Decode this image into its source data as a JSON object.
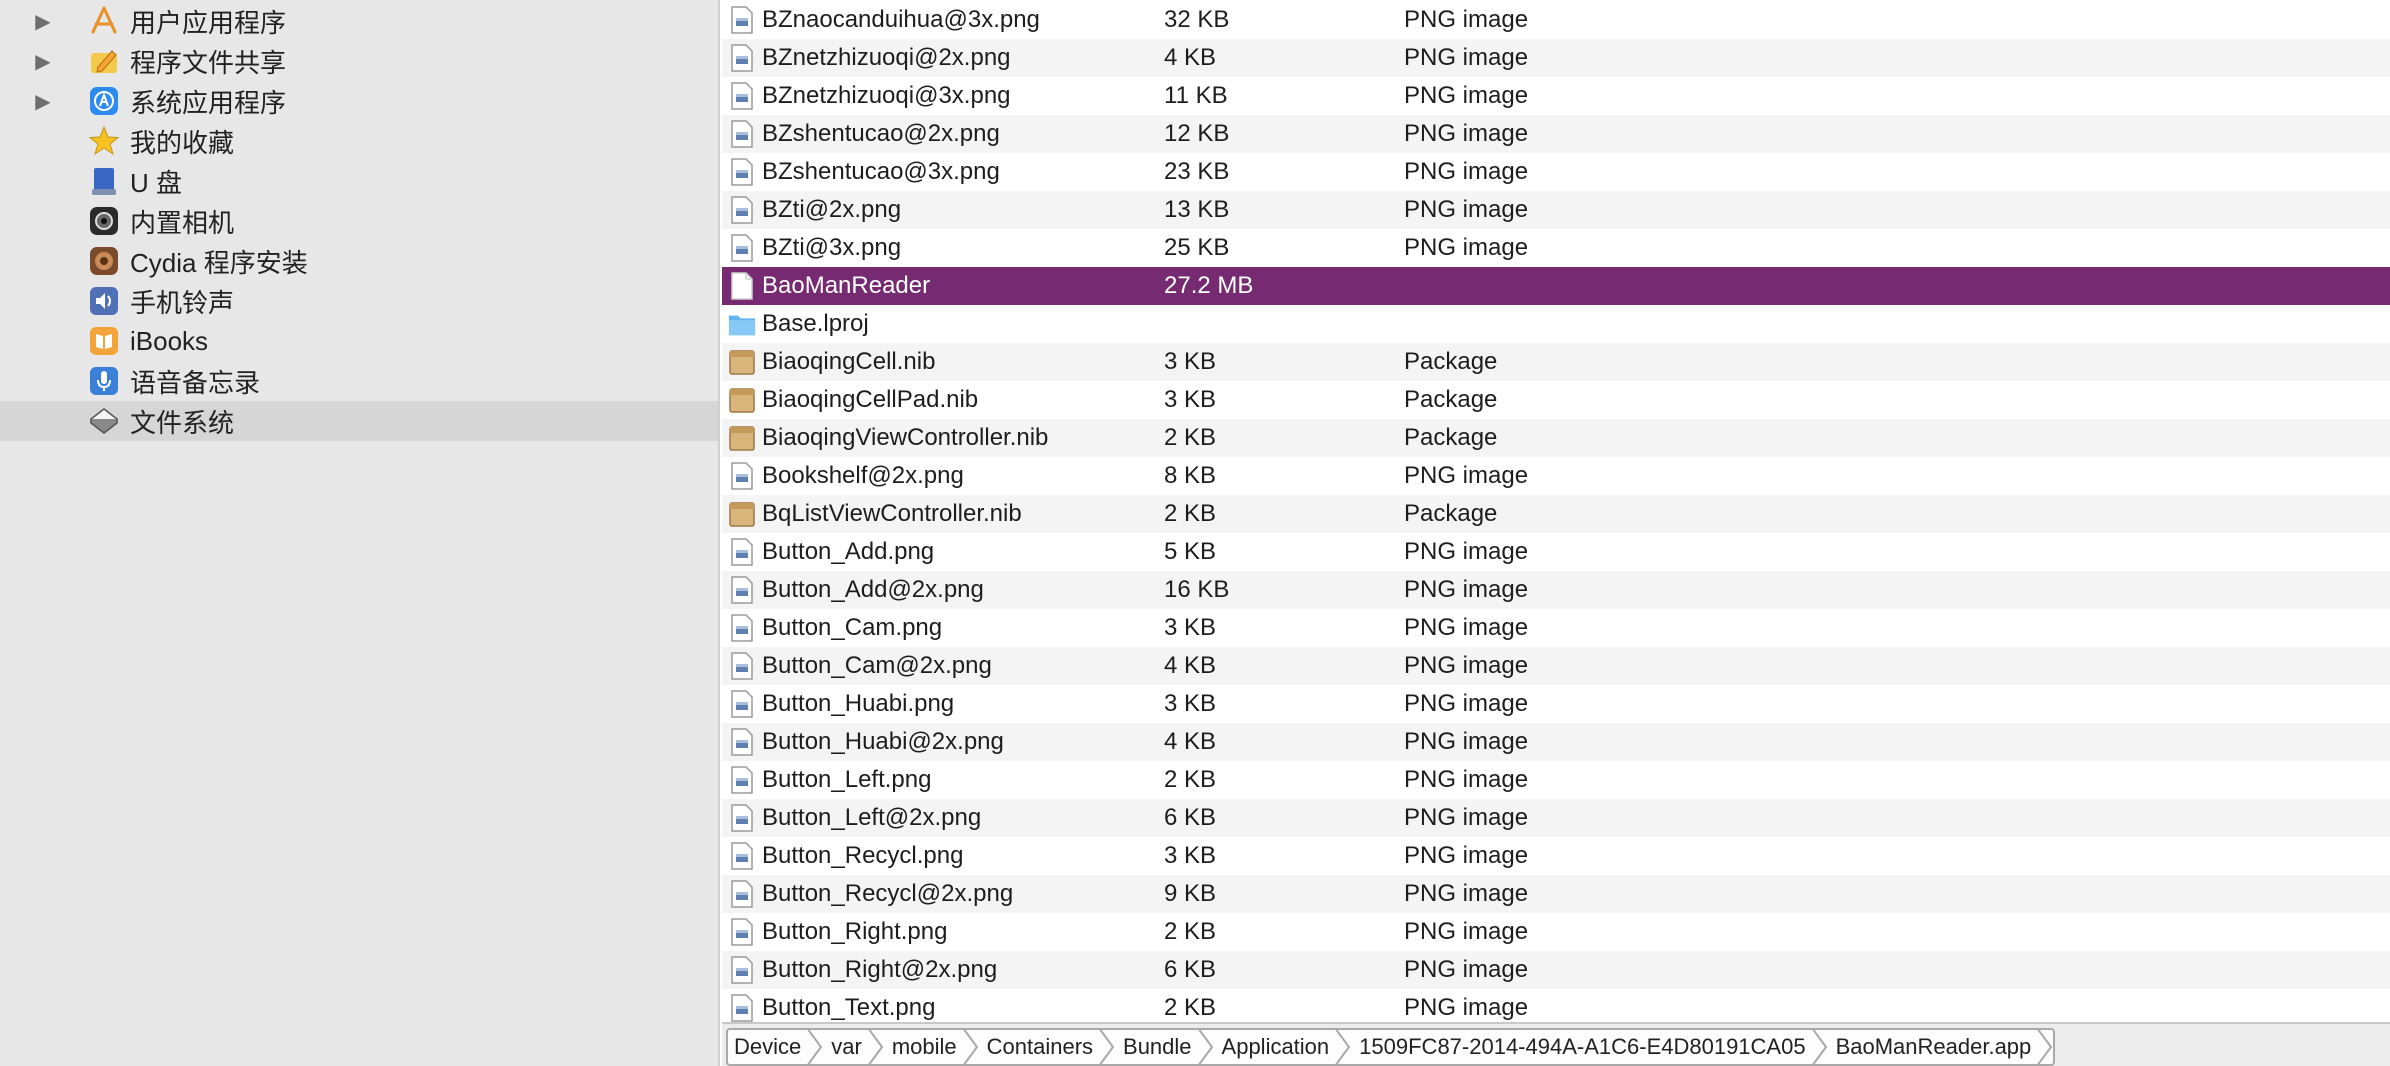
{
  "sidebar": {
    "items": [
      {
        "label": "用户应用程序",
        "icon": "app-store-icon",
        "expandable": true,
        "selected": false
      },
      {
        "label": "程序文件共享",
        "icon": "pencil-folder-icon",
        "expandable": true,
        "selected": false
      },
      {
        "label": "系统应用程序",
        "icon": "blue-app-icon",
        "expandable": true,
        "selected": false
      },
      {
        "label": "我的收藏",
        "icon": "star-icon",
        "expandable": false,
        "selected": false
      },
      {
        "label": "U 盘",
        "icon": "usb-drive-icon",
        "expandable": false,
        "selected": false
      },
      {
        "label": "内置相机",
        "icon": "camera-icon",
        "expandable": false,
        "selected": false
      },
      {
        "label": "Cydia 程序安装",
        "icon": "cydia-icon",
        "expandable": false,
        "selected": false
      },
      {
        "label": "手机铃声",
        "icon": "speaker-icon",
        "expandable": false,
        "selected": false
      },
      {
        "label": "iBooks",
        "icon": "ibooks-icon",
        "expandable": false,
        "selected": false
      },
      {
        "label": "语音备忘录",
        "icon": "microphone-icon",
        "expandable": false,
        "selected": false
      },
      {
        "label": "文件系统",
        "icon": "filesystem-icon",
        "expandable": false,
        "selected": true
      }
    ]
  },
  "files": [
    {
      "name": "BZnaocanduihua@3x.png",
      "size": "32 KB",
      "kind": "PNG image",
      "icon": "png-file-icon"
    },
    {
      "name": "BZnetzhizuoqi@2x.png",
      "size": "4 KB",
      "kind": "PNG image",
      "icon": "png-file-icon"
    },
    {
      "name": "BZnetzhizuoqi@3x.png",
      "size": "11 KB",
      "kind": "PNG image",
      "icon": "png-file-icon"
    },
    {
      "name": "BZshentucao@2x.png",
      "size": "12 KB",
      "kind": "PNG image",
      "icon": "png-file-icon"
    },
    {
      "name": "BZshentucao@3x.png",
      "size": "23 KB",
      "kind": "PNG image",
      "icon": "png-file-icon"
    },
    {
      "name": "BZti@2x.png",
      "size": "13 KB",
      "kind": "PNG image",
      "icon": "png-file-icon"
    },
    {
      "name": "BZti@3x.png",
      "size": "25 KB",
      "kind": "PNG image",
      "icon": "png-file-icon"
    },
    {
      "name": "BaoManReader",
      "size": "27.2 MB",
      "kind": "",
      "icon": "blank-file-icon",
      "selected": true
    },
    {
      "name": "Base.lproj",
      "size": "",
      "kind": "",
      "icon": "folder-icon"
    },
    {
      "name": "BiaoqingCell.nib",
      "size": "3 KB",
      "kind": "Package",
      "icon": "package-icon"
    },
    {
      "name": "BiaoqingCellPad.nib",
      "size": "3 KB",
      "kind": "Package",
      "icon": "package-icon"
    },
    {
      "name": "BiaoqingViewController.nib",
      "size": "2 KB",
      "kind": "Package",
      "icon": "package-icon"
    },
    {
      "name": "Bookshelf@2x.png",
      "size": "8 KB",
      "kind": "PNG image",
      "icon": "png-file-icon"
    },
    {
      "name": "BqListViewController.nib",
      "size": "2 KB",
      "kind": "Package",
      "icon": "package-icon"
    },
    {
      "name": "Button_Add.png",
      "size": "5 KB",
      "kind": "PNG image",
      "icon": "png-file-icon"
    },
    {
      "name": "Button_Add@2x.png",
      "size": "16 KB",
      "kind": "PNG image",
      "icon": "png-file-icon"
    },
    {
      "name": "Button_Cam.png",
      "size": "3 KB",
      "kind": "PNG image",
      "icon": "png-file-icon"
    },
    {
      "name": "Button_Cam@2x.png",
      "size": "4 KB",
      "kind": "PNG image",
      "icon": "png-file-icon"
    },
    {
      "name": "Button_Huabi.png",
      "size": "3 KB",
      "kind": "PNG image",
      "icon": "png-file-icon"
    },
    {
      "name": "Button_Huabi@2x.png",
      "size": "4 KB",
      "kind": "PNG image",
      "icon": "png-file-icon"
    },
    {
      "name": "Button_Left.png",
      "size": "2 KB",
      "kind": "PNG image",
      "icon": "png-file-icon"
    },
    {
      "name": "Button_Left@2x.png",
      "size": "6 KB",
      "kind": "PNG image",
      "icon": "png-file-icon"
    },
    {
      "name": "Button_Recycl.png",
      "size": "3 KB",
      "kind": "PNG image",
      "icon": "png-file-icon"
    },
    {
      "name": "Button_Recycl@2x.png",
      "size": "9 KB",
      "kind": "PNG image",
      "icon": "png-file-icon"
    },
    {
      "name": "Button_Right.png",
      "size": "2 KB",
      "kind": "PNG image",
      "icon": "png-file-icon"
    },
    {
      "name": "Button_Right@2x.png",
      "size": "6 KB",
      "kind": "PNG image",
      "icon": "png-file-icon"
    },
    {
      "name": "Button_Text.png",
      "size": "2 KB",
      "kind": "PNG image",
      "icon": "png-file-icon"
    }
  ],
  "pathbar": {
    "crumbs": [
      "Device",
      "var",
      "mobile",
      "Containers",
      "Bundle",
      "Application",
      "1509FC87-2014-494A-A1C6-E4D80191CA05",
      "BaoManReader.app"
    ]
  },
  "colors": {
    "selection": "#762a72",
    "sidebar_bg": "#e7e7e7",
    "sidebar_selected": "#d6d6d6",
    "row_alt": "#f4f4f4"
  }
}
